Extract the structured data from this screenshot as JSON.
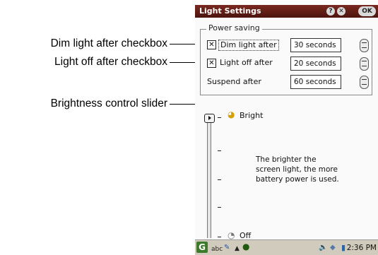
{
  "callouts": {
    "dim": "Dim light after checkbox",
    "off": "Light off after checkbox",
    "slider": "Brightness control slider"
  },
  "window": {
    "title": "Light Settings",
    "help_label": "?",
    "close_label": "✕",
    "ok_label": "OK"
  },
  "power_saving": {
    "legend": "Power saving",
    "dim": {
      "label": "Dim light after",
      "checked": true,
      "check_mark": "✕",
      "value": "30 seconds"
    },
    "off": {
      "label": "Light off after",
      "checked": true,
      "check_mark": "✕",
      "value": "20 seconds"
    },
    "suspend": {
      "label": "Suspend after",
      "value": "60 seconds"
    }
  },
  "brightness": {
    "top_label": "Bright",
    "bottom_label": "Off",
    "level": 1.0,
    "info_text": "The brighter the screen light, the more battery power is used."
  },
  "taskbar": {
    "start_label": "G",
    "input_mode": "abc",
    "clock": "2:36 PM",
    "icons": [
      "start-icon",
      "pen-icon",
      "arrow-up-icon",
      "globe-icon",
      "speaker-icon",
      "network-icon",
      "battery-icon"
    ]
  }
}
